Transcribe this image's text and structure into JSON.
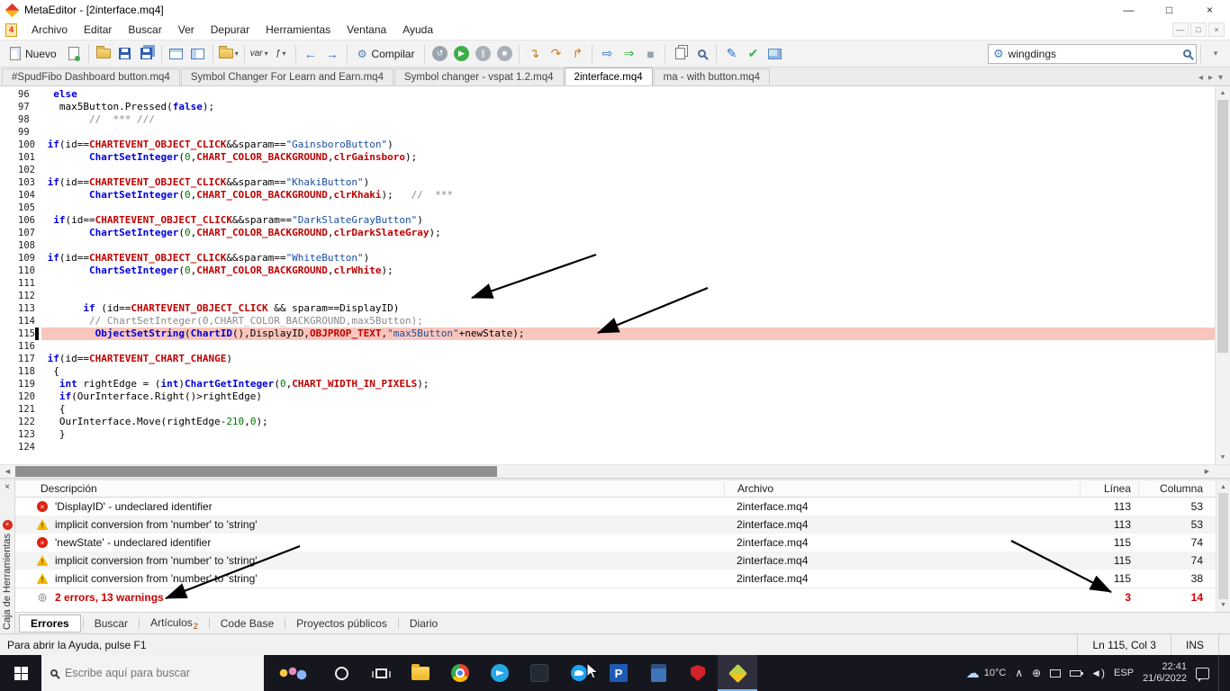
{
  "window": {
    "title": "MetaEditor - [2interface.mq4]",
    "controls": {
      "min": "—",
      "max": "□",
      "close": "×"
    }
  },
  "mdi": {
    "min": "—",
    "restore": "□",
    "close": "×"
  },
  "menu": {
    "items": [
      "Archivo",
      "Editar",
      "Buscar",
      "Ver",
      "Depurar",
      "Herramientas",
      "Ventana",
      "Ayuda"
    ]
  },
  "toolbar": {
    "search_value": "wingdings",
    "items": [
      {
        "kind": "btn",
        "name": "new-button",
        "icon": "page",
        "label": "Nuevo"
      },
      {
        "kind": "icon",
        "name": "new-template-button",
        "icon": "page2"
      },
      {
        "kind": "sep"
      },
      {
        "kind": "icon",
        "name": "open-file-button",
        "icon": "folder"
      },
      {
        "kind": "icon",
        "name": "save-button",
        "icon": "floppy"
      },
      {
        "kind": "icon",
        "name": "save-all-button",
        "icon": "floppy2"
      },
      {
        "kind": "sep"
      },
      {
        "kind": "icon",
        "name": "split-vertical-button",
        "icon": "winpane"
      },
      {
        "kind": "icon",
        "name": "split-horizontal-button",
        "icon": "winpane2"
      },
      {
        "kind": "sep"
      },
      {
        "kind": "icon",
        "name": "profiles-button",
        "icon": "folder",
        "dd": true
      },
      {
        "kind": "sep"
      },
      {
        "kind": "icon",
        "name": "insert-variable-button",
        "glyph": "var",
        "small": true,
        "dd": true
      },
      {
        "kind": "icon",
        "name": "insert-function-button",
        "glyph": "ƒ",
        "small": true,
        "dd": true
      },
      {
        "kind": "sep"
      },
      {
        "kind": "icon",
        "name": "back-button",
        "glyph": "←",
        "color": "#2b6cc4"
      },
      {
        "kind": "icon",
        "name": "forward-button",
        "glyph": "→",
        "color": "#2b6cc4"
      },
      {
        "kind": "sep"
      },
      {
        "kind": "btn",
        "name": "compile-button",
        "glyph": "⚙",
        "gcolor": "#4a7ebb",
        "label": "Compilar"
      },
      {
        "kind": "sep"
      },
      {
        "kind": "icon",
        "name": "debug-restart-button",
        "circle": "#9aa4ad",
        "glyph": "↺"
      },
      {
        "kind": "icon",
        "name": "debug-start-button",
        "circle": "#3fae49",
        "glyph": "▶"
      },
      {
        "kind": "icon",
        "name": "debug-pause-button",
        "circle": "#a8b0b8",
        "glyph": "∥"
      },
      {
        "kind": "icon",
        "name": "debug-stop-button",
        "circle": "#a8b0b8",
        "glyph": "■"
      },
      {
        "kind": "sep"
      },
      {
        "kind": "icon",
        "name": "step-into-button",
        "glyph": "↴",
        "color": "#c87d2a"
      },
      {
        "kind": "icon",
        "name": "step-over-button",
        "glyph": "↷",
        "color": "#c87d2a"
      },
      {
        "kind": "icon",
        "name": "step-out-button",
        "glyph": "↱",
        "color": "#c87d2a"
      },
      {
        "kind": "sep"
      },
      {
        "kind": "icon",
        "name": "run-to-cursor-button",
        "glyph": "⇨",
        "color": "#2b6cc4"
      },
      {
        "kind": "icon",
        "name": "continue-button",
        "glyph": "⇒",
        "color": "#3fae49"
      },
      {
        "kind": "icon",
        "name": "break-button",
        "glyph": "■",
        "color": "#9aa4ad"
      },
      {
        "kind": "sep"
      },
      {
        "kind": "icon",
        "name": "copy-button",
        "icon": "copy"
      },
      {
        "kind": "icon",
        "name": "preview-button",
        "icon": "magnifier"
      },
      {
        "kind": "sep"
      },
      {
        "kind": "icon",
        "name": "styler-button",
        "glyph": "✎",
        "color": "#2b6cc4"
      },
      {
        "kind": "icon",
        "name": "style-check-button",
        "glyph": "✔",
        "color": "#3fae49"
      },
      {
        "kind": "icon",
        "name": "screenshot-button",
        "icon": "image"
      }
    ]
  },
  "file_tabs": [
    {
      "label": "#SpudFibo Dashboard button.mq4",
      "active": false
    },
    {
      "label": "Symbol Changer For Learn and Earn.mq4",
      "active": false
    },
    {
      "label": "Symbol changer - vspat 1.2.mq4",
      "active": false
    },
    {
      "label": "2interface.mq4",
      "active": true
    },
    {
      "label": "ma - with button.mq4",
      "active": false
    }
  ],
  "editor": {
    "caret_line": 115,
    "caret_position": "Ln 115, Col 3",
    "highlight_color": "#f9c6bd",
    "lines": [
      {
        "n": 96,
        "t": [
          [
            "p",
            "  "
          ],
          [
            "kw",
            "else"
          ]
        ]
      },
      {
        "n": 97,
        "t": [
          [
            "p",
            "   max5Button.Pressed("
          ],
          [
            "kw",
            "false"
          ],
          [
            "p",
            ");"
          ]
        ]
      },
      {
        "n": 98,
        "t": [
          [
            "p",
            "        "
          ],
          [
            "cm",
            "//  *** ///"
          ]
        ]
      },
      {
        "n": 99,
        "t": []
      },
      {
        "n": 100,
        "t": [
          [
            "p",
            " "
          ],
          [
            "kw",
            "if"
          ],
          [
            "p",
            "(id=="
          ],
          [
            "c",
            "CHARTEVENT_OBJECT_CLICK"
          ],
          [
            "p",
            "&&sparam=="
          ],
          [
            "s",
            "\"GainsboroButton\""
          ],
          [
            "p",
            ")"
          ]
        ]
      },
      {
        "n": 101,
        "t": [
          [
            "p",
            "        "
          ],
          [
            "fn",
            "ChartSetInteger"
          ],
          [
            "p",
            "("
          ],
          [
            "n",
            "0"
          ],
          [
            "p",
            ","
          ],
          [
            "c",
            "CHART_COLOR_BACKGROUND"
          ],
          [
            "p",
            ","
          ],
          [
            "c",
            "clrGains­boro"
          ],
          [
            "p",
            ");"
          ]
        ]
      },
      {
        "n": 102,
        "t": []
      },
      {
        "n": 103,
        "t": [
          [
            "p",
            " "
          ],
          [
            "kw",
            "if"
          ],
          [
            "p",
            "(id=="
          ],
          [
            "c",
            "CHARTEVENT_OBJECT_CLICK"
          ],
          [
            "p",
            "&&sparam=="
          ],
          [
            "s",
            "\"KhakiButton\""
          ],
          [
            "p",
            ")"
          ]
        ]
      },
      {
        "n": 104,
        "t": [
          [
            "p",
            "        "
          ],
          [
            "fn",
            "ChartSetInteger"
          ],
          [
            "p",
            "("
          ],
          [
            "n",
            "0"
          ],
          [
            "p",
            ","
          ],
          [
            "c",
            "CHART_COLOR_BACKGROUND"
          ],
          [
            "p",
            ","
          ],
          [
            "c",
            "clrKhaki"
          ],
          [
            "p",
            ");   "
          ],
          [
            "cm",
            "//  ***"
          ]
        ]
      },
      {
        "n": 105,
        "t": []
      },
      {
        "n": 106,
        "t": [
          [
            "p",
            "  "
          ],
          [
            "kw",
            "if"
          ],
          [
            "p",
            "(id=="
          ],
          [
            "c",
            "CHARTEVENT_OBJECT_CLICK"
          ],
          [
            "p",
            "&&sparam=="
          ],
          [
            "s",
            "\"DarkSlateGrayButton\""
          ],
          [
            "p",
            ")"
          ]
        ]
      },
      {
        "n": 107,
        "t": [
          [
            "p",
            "        "
          ],
          [
            "fn",
            "ChartSetInteger"
          ],
          [
            "p",
            "("
          ],
          [
            "n",
            "0"
          ],
          [
            "p",
            ","
          ],
          [
            "c",
            "CHART_COLOR_BACKGROUND"
          ],
          [
            "p",
            ","
          ],
          [
            "c",
            "clrDarkSlateGray"
          ],
          [
            "p",
            ");"
          ]
        ]
      },
      {
        "n": 108,
        "t": []
      },
      {
        "n": 109,
        "t": [
          [
            "p",
            " "
          ],
          [
            "kw",
            "if"
          ],
          [
            "p",
            "(id=="
          ],
          [
            "c",
            "CHARTEVENT_OBJECT_CLICK"
          ],
          [
            "p",
            "&&sparam=="
          ],
          [
            "s",
            "\"WhiteButton\""
          ],
          [
            "p",
            ")"
          ]
        ]
      },
      {
        "n": 110,
        "t": [
          [
            "p",
            "        "
          ],
          [
            "fn",
            "ChartSetInteger"
          ],
          [
            "p",
            "("
          ],
          [
            "n",
            "0"
          ],
          [
            "p",
            ","
          ],
          [
            "c",
            "CHART_COLOR_BACKGROUND"
          ],
          [
            "p",
            ","
          ],
          [
            "c",
            "clrWhite"
          ],
          [
            "p",
            ");"
          ]
        ]
      },
      {
        "n": 111,
        "t": []
      },
      {
        "n": 112,
        "t": []
      },
      {
        "n": 113,
        "t": [
          [
            "p",
            "       "
          ],
          [
            "kw",
            "if"
          ],
          [
            "p",
            " (id=="
          ],
          [
            "c",
            "CHARTEVENT_OBJECT_CLICK"
          ],
          [
            "p",
            " && sparam==DisplayID)"
          ]
        ]
      },
      {
        "n": 114,
        "t": [
          [
            "p",
            "        "
          ],
          [
            "cm",
            "// ChartSetInteger(0,CHART_COLOR_BACKGROUND,max5Button);"
          ]
        ]
      },
      {
        "n": 115,
        "t": [
          [
            "p",
            "         "
          ],
          [
            "fn",
            "ObjectSetString"
          ],
          [
            "p",
            "("
          ],
          [
            "fn",
            "ChartID"
          ],
          [
            "p",
            "(),DisplayID,"
          ],
          [
            "c",
            "OBJPROP_TEXT"
          ],
          [
            "p",
            ","
          ],
          [
            "s",
            "\"max5Button\""
          ],
          [
            "p",
            "+newState);"
          ]
        ]
      },
      {
        "n": 116,
        "t": []
      },
      {
        "n": 117,
        "t": [
          [
            "p",
            " "
          ],
          [
            "kw",
            "if"
          ],
          [
            "p",
            "(id=="
          ],
          [
            "c",
            "CHARTEVENT_CHART_CHANGE"
          ],
          [
            "p",
            ")"
          ]
        ]
      },
      {
        "n": 118,
        "t": [
          [
            "p",
            "  {"
          ]
        ]
      },
      {
        "n": 119,
        "t": [
          [
            "p",
            "   "
          ],
          [
            "kw",
            "int"
          ],
          [
            "p",
            " rightEdge = ("
          ],
          [
            "kw",
            "int"
          ],
          [
            "p",
            ")"
          ],
          [
            "fn",
            "ChartGetInteger"
          ],
          [
            "p",
            "("
          ],
          [
            "n",
            "0"
          ],
          [
            "p",
            ","
          ],
          [
            "c",
            "CHART_WIDTH_IN_PIXELS"
          ],
          [
            "p",
            ");"
          ]
        ]
      },
      {
        "n": 120,
        "t": [
          [
            "p",
            "   "
          ],
          [
            "kw",
            "if"
          ],
          [
            "p",
            "(OurInterface.Right()>rightEdge)"
          ]
        ]
      },
      {
        "n": 121,
        "t": [
          [
            "p",
            "   {"
          ]
        ]
      },
      {
        "n": 122,
        "t": [
          [
            "p",
            "   OurInterface.Move(rightEdge-"
          ],
          [
            "n",
            "210"
          ],
          [
            "p",
            ","
          ],
          [
            "n",
            "0"
          ],
          [
            "p",
            ");"
          ]
        ]
      },
      {
        "n": 123,
        "t": [
          [
            "p",
            "   }"
          ]
        ]
      },
      {
        "n": 124,
        "t": []
      }
    ]
  },
  "panel": {
    "strip_title": "Caja de Herramientas",
    "columns": [
      "Descripción",
      "Archivo",
      "Línea",
      "Columna"
    ],
    "rows": [
      {
        "type": "error",
        "desc": "'DisplayID' - undeclared identifier",
        "file": "2interface.mq4",
        "line": "113",
        "col": "53"
      },
      {
        "type": "warning",
        "desc": "implicit conversion from 'number' to 'string'",
        "file": "2interface.mq4",
        "line": "113",
        "col": "53"
      },
      {
        "type": "error",
        "desc": "'newState' - undeclared identifier",
        "file": "2interface.mq4",
        "line": "115",
        "col": "74"
      },
      {
        "type": "warning",
        "desc": "implicit conversion from 'number' to 'string'",
        "file": "2interface.mq4",
        "line": "115",
        "col": "74"
      },
      {
        "type": "warning",
        "desc": "implicit conversion from 'number' to 'string'",
        "file": "2interface.mq4",
        "line": "115",
        "col": "38"
      },
      {
        "type": "summary",
        "desc": "2 errors, 13 warnings",
        "file": "",
        "line": "3",
        "col": "14"
      }
    ]
  },
  "bottom_tabs": [
    {
      "label": "Errores",
      "active": true
    },
    {
      "label": "Buscar"
    },
    {
      "label": "Artículos",
      "sub": "2"
    },
    {
      "label": "Code Base"
    },
    {
      "label": "Proyectos públicos"
    },
    {
      "label": "Diario"
    }
  ],
  "status": {
    "help": "Para abrir la Ayuda, pulse F1",
    "position": "Ln 115, Col 3",
    "mode": "INS"
  },
  "taskbar": {
    "search_placeholder": "Escribe aquí para buscar",
    "apps": [
      {
        "name": "widgets",
        "wide": true
      },
      {
        "name": "cortana"
      },
      {
        "name": "task-view"
      },
      {
        "name": "file-explorer"
      },
      {
        "name": "chrome"
      },
      {
        "name": "telegram"
      },
      {
        "name": "metatrader"
      },
      {
        "name": "twitter"
      },
      {
        "name": "publisher",
        "glyph": "P"
      },
      {
        "name": "calculator"
      },
      {
        "name": "security"
      },
      {
        "name": "metaeditor",
        "active": true
      }
    ],
    "tray": {
      "temp": "10°C",
      "lang": "ESP",
      "time": "22:41",
      "date": "21/6/2022"
    }
  },
  "colors": {
    "error": "#dd2211",
    "warning": "#f5b800",
    "line_highlight": "#f9c6bd",
    "taskbar_accent": "#76b9ed"
  }
}
